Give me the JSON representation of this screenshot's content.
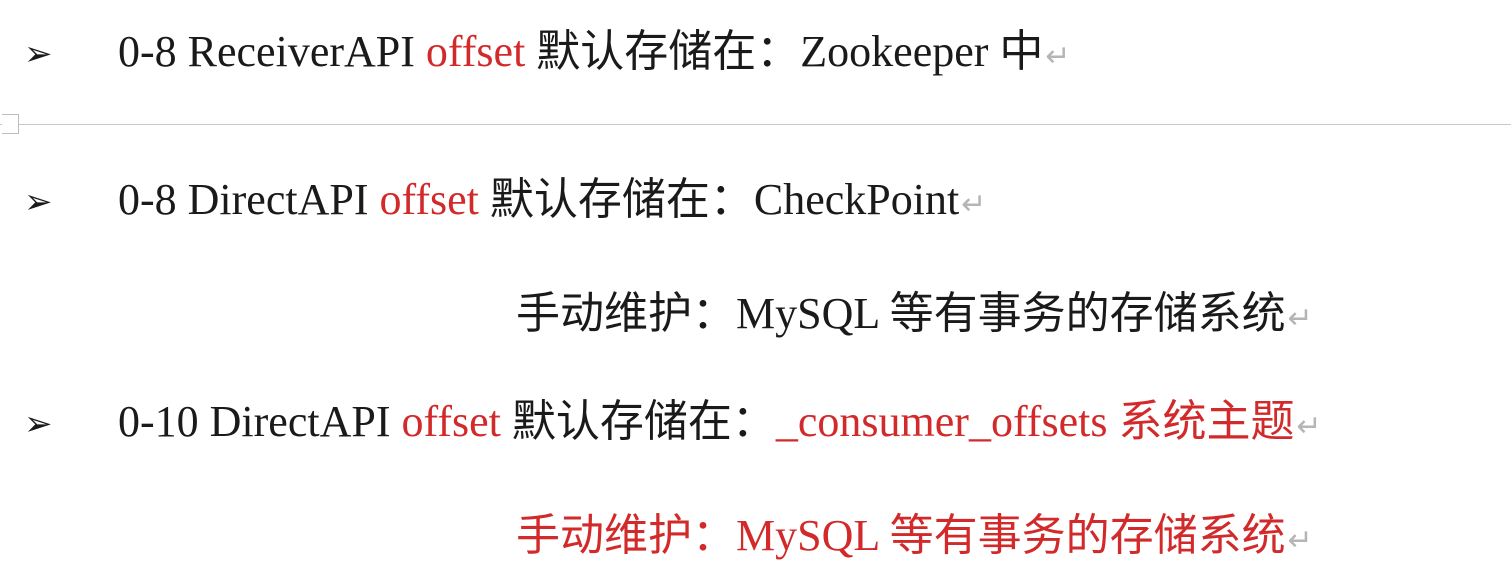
{
  "document": {
    "items": [
      {
        "bullet": "➢",
        "prefix": "0-8 ReceiverAPI ",
        "highlight": "offset",
        "suffix": " 默认存储在：Zookeeper 中"
      },
      {
        "bullet": "➢",
        "prefix": "0-8 DirectAPI ",
        "highlight": "offset",
        "suffix": " 默认存储在：CheckPoint",
        "note": "手动维护：MySQL 等有事务的存储系统"
      },
      {
        "bullet": "➢",
        "prefix": "0-10 DirectAPI ",
        "highlight": "offset",
        "suffix": " 默认存储在：",
        "red_tail": "_consumer_offsets 系统主题",
        "note": "手动维护：MySQL 等有事务的存储系统"
      }
    ],
    "paragraph_mark": "↵",
    "colors": {
      "text": "#1a1a1a",
      "highlight": "#d22a2a",
      "paragraph_mark": "#b5b5b5"
    }
  }
}
